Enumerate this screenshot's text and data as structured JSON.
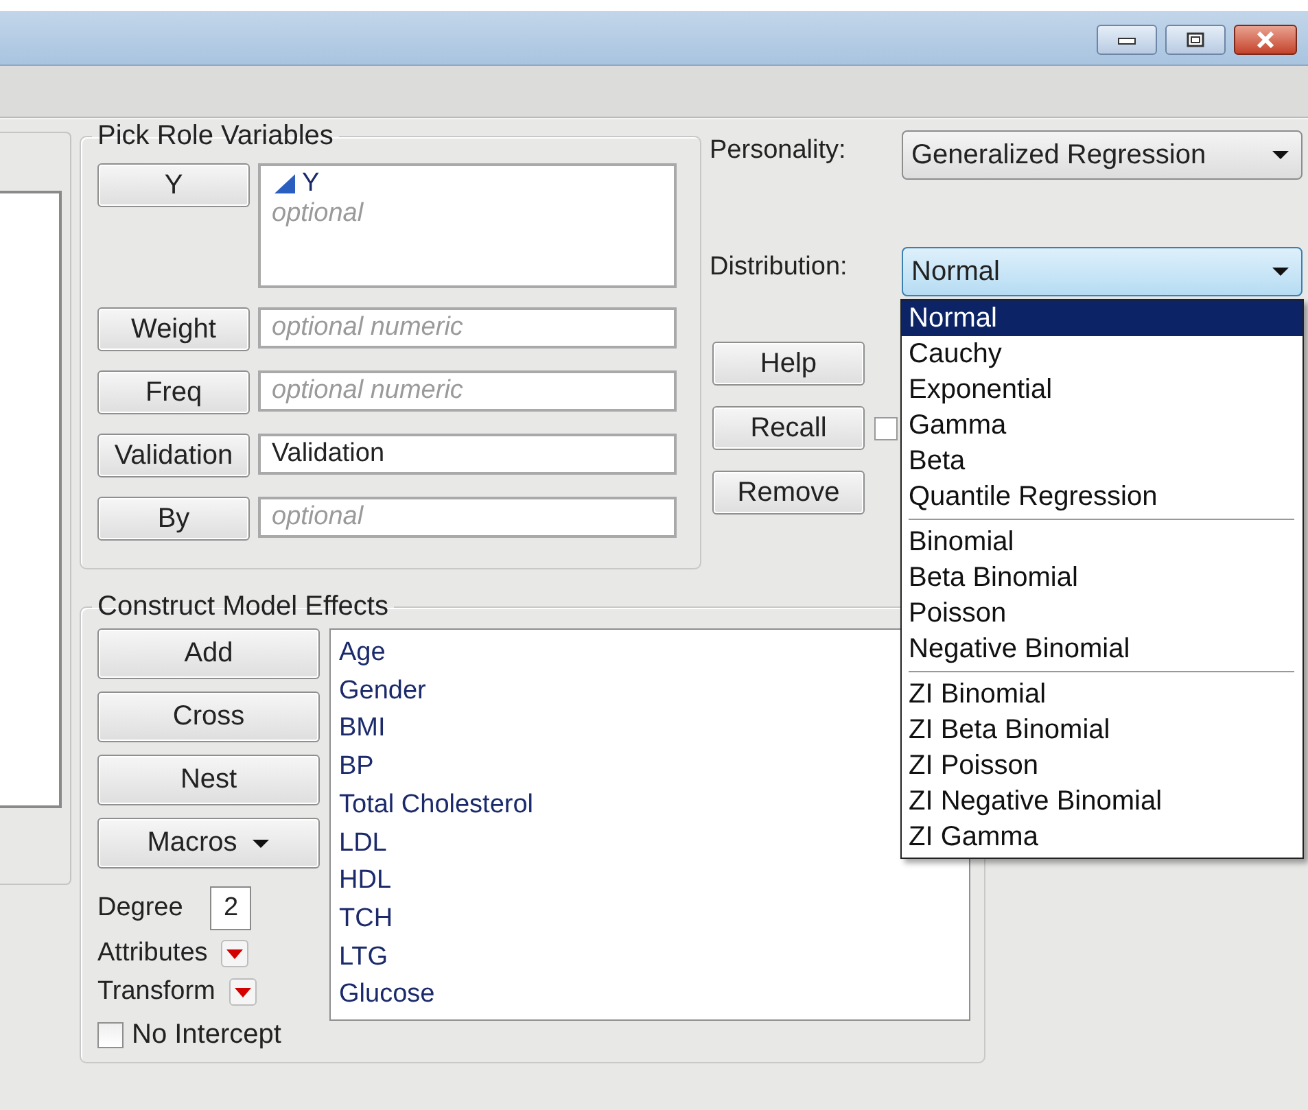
{
  "pick_role_variables": {
    "title": "Pick Role Variables",
    "roles": [
      {
        "button": "Y",
        "variables": [
          "Y"
        ],
        "placeholder": "optional"
      },
      {
        "button": "Weight",
        "placeholder": "optional numeric"
      },
      {
        "button": "Freq",
        "placeholder": "optional numeric"
      },
      {
        "button": "Validation",
        "value": "Validation"
      },
      {
        "button": "By",
        "placeholder": "optional"
      }
    ]
  },
  "personality": {
    "label": "Personality:",
    "value": "Generalized Regression"
  },
  "distribution": {
    "label": "Distribution:",
    "value": "Normal",
    "expanded": true,
    "option_groups": [
      {
        "options": [
          {
            "label": "Normal",
            "selected": true
          },
          {
            "label": "Cauchy",
            "selected": false
          },
          {
            "label": "Exponential",
            "selected": false
          },
          {
            "label": "Gamma",
            "selected": false
          },
          {
            "label": "Beta",
            "selected": false
          },
          {
            "label": "Quantile Regression",
            "selected": false
          }
        ]
      },
      {
        "options": [
          {
            "label": "Binomial",
            "selected": false
          },
          {
            "label": "Beta Binomial",
            "selected": false
          },
          {
            "label": "Poisson",
            "selected": false
          },
          {
            "label": "Negative Binomial",
            "selected": false
          }
        ]
      },
      {
        "options": [
          {
            "label": "ZI Binomial",
            "selected": false
          },
          {
            "label": "ZI Beta Binomial",
            "selected": false
          },
          {
            "label": "ZI Poisson",
            "selected": false
          },
          {
            "label": "ZI Negative Binomial",
            "selected": false
          },
          {
            "label": "ZI Gamma",
            "selected": false
          }
        ]
      }
    ]
  },
  "action_buttons": [
    "Help",
    "Recall",
    "Remove"
  ],
  "side_checkbox": {
    "checked": false
  },
  "construct_model_effects": {
    "title": "Construct Model Effects",
    "buttons": [
      "Add",
      "Cross",
      "Nest"
    ],
    "macros": "Macros",
    "degree": {
      "label": "Degree",
      "value": "2"
    },
    "menus": [
      "Attributes",
      "Transform"
    ],
    "no_intercept": {
      "label": "No Intercept",
      "checked": false
    },
    "effects": [
      "Age",
      "Gender",
      "BMI",
      "BP",
      "Total Cholesterol",
      "LDL",
      "HDL",
      "TCH",
      "LTG",
      "Glucose"
    ]
  }
}
